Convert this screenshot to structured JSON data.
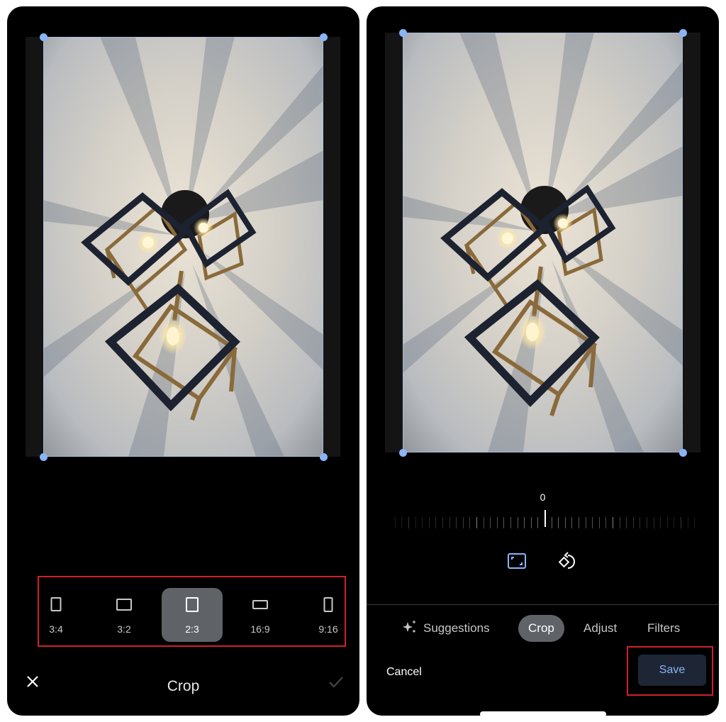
{
  "left_screen": {
    "title": "Crop",
    "close_icon": "close-icon",
    "confirm_icon": "check-icon",
    "aspect_ratios": [
      {
        "label": "3:4",
        "icon": "portrait-rect-icon",
        "selected": false
      },
      {
        "label": "3:2",
        "icon": "landscape-rect-icon",
        "selected": false
      },
      {
        "label": "2:3",
        "icon": "portrait-rect-icon",
        "selected": true
      },
      {
        "label": "16:9",
        "icon": "wide-rect-icon",
        "selected": false
      },
      {
        "label": "9:16",
        "icon": "tall-rect-icon",
        "selected": false
      }
    ],
    "highlight_color": "#d0202a"
  },
  "right_screen": {
    "straighten_angle": "0",
    "tools": [
      {
        "name": "aspect-ratio",
        "icon": "aspect-ratio-icon",
        "active": true
      },
      {
        "name": "rotate",
        "icon": "rotate-icon",
        "active": false
      }
    ],
    "tabs": [
      {
        "label": "Suggestions",
        "icon": "sparkle-icon",
        "active": false
      },
      {
        "label": "Crop",
        "active": true
      },
      {
        "label": "Adjust",
        "active": false
      },
      {
        "label": "Filters",
        "active": false
      }
    ],
    "cancel_label": "Cancel",
    "save_label": "Save",
    "highlight_color": "#d0202a"
  },
  "photo": {
    "subject": "Three cube pendant lights on a ceiling with radial shadows"
  },
  "colors": {
    "accent": "#8ab4f8",
    "selected_chip": "#5f6368",
    "save_bg": "#1e2635"
  }
}
